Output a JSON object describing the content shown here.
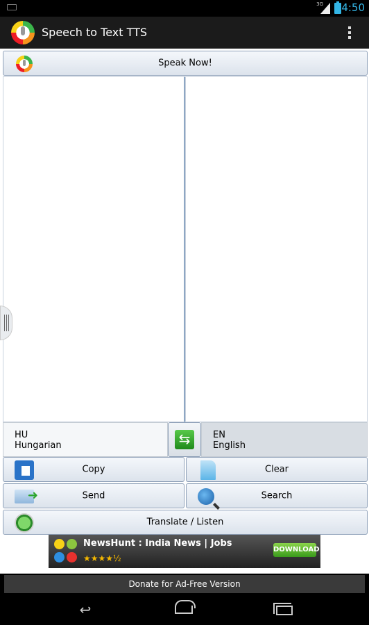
{
  "status_bar": {
    "network": "3G",
    "time": "4:50"
  },
  "action_bar": {
    "title": "Speech to Text TTS"
  },
  "speak_button": {
    "label": "Speak Now!"
  },
  "source_language": {
    "code": "HU",
    "name": "Hungarian"
  },
  "target_language": {
    "code": "EN",
    "name": "English"
  },
  "buttons": {
    "copy": "Copy",
    "clear": "Clear",
    "send": "Send",
    "search": "Search",
    "translate_listen": "Translate / Listen"
  },
  "ad": {
    "title": "NewsHunt : India News | Jobs",
    "rating": "★★★★½",
    "button": "DOWNLOAD"
  },
  "donate": {
    "label": "Donate for Ad-Free Version"
  },
  "colors": {
    "accent": "#33b5e5",
    "action_bar": "#1b1b1b",
    "button_border": "#8ea0b8"
  }
}
